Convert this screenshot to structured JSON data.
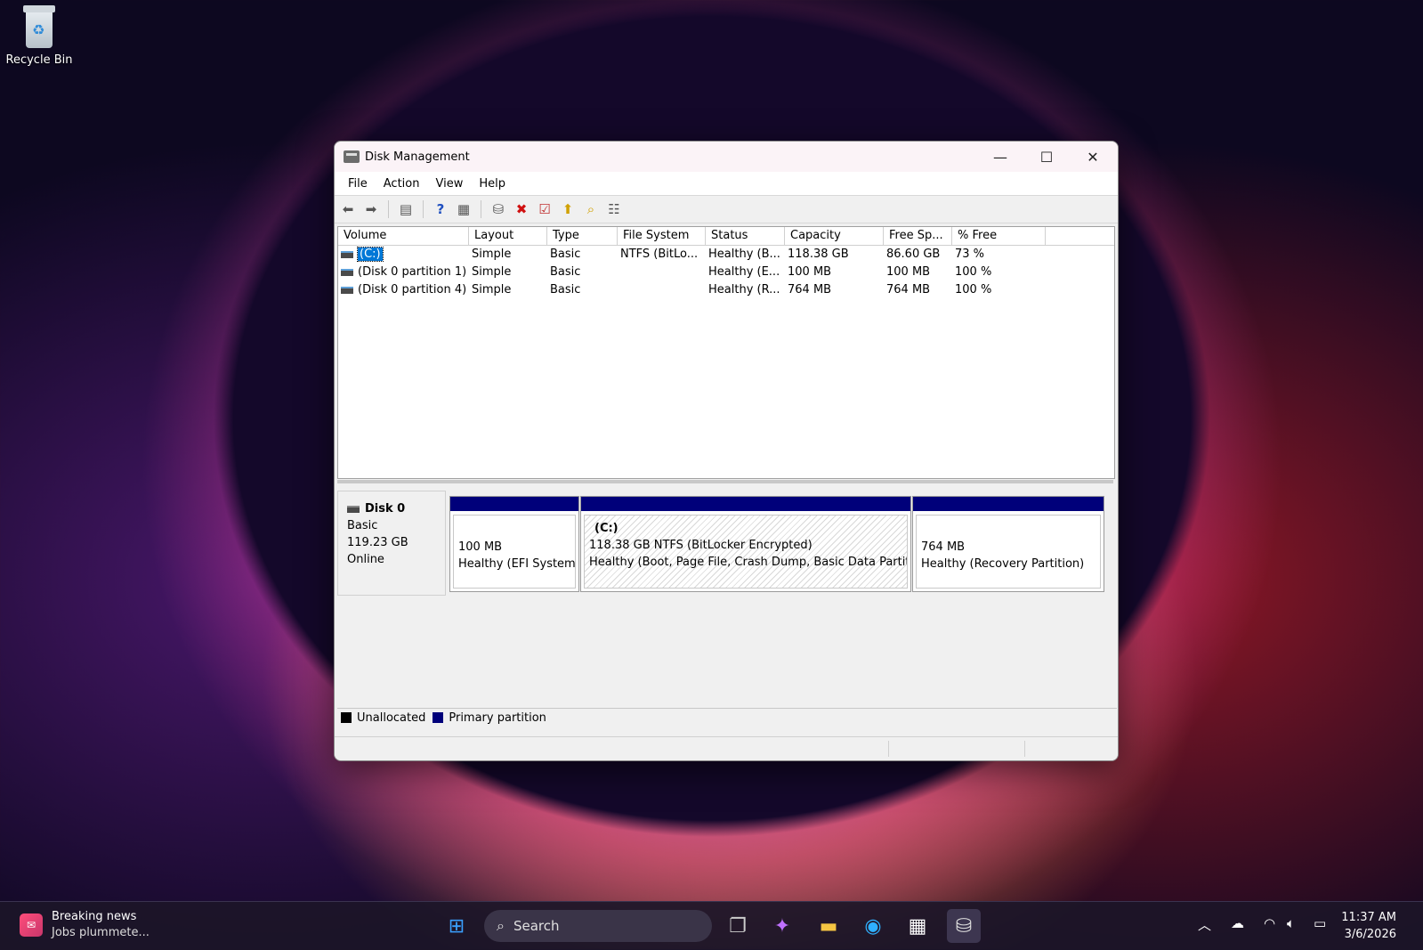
{
  "desktop": {
    "recycle_bin_label": "Recycle Bin"
  },
  "window": {
    "title": "Disk Management",
    "menu": [
      "File",
      "Action",
      "View",
      "Help"
    ],
    "columns": [
      "Volume",
      "Layout",
      "Type",
      "File System",
      "Status",
      "Capacity",
      "Free Sp...",
      "% Free"
    ],
    "rows": [
      {
        "volume": "(C:)",
        "layout": "Simple",
        "type": "Basic",
        "fs": "NTFS (BitLo...",
        "status": "Healthy (B...",
        "capacity": "118.38 GB",
        "free": "86.60 GB",
        "pct": "73 %"
      },
      {
        "volume": "(Disk 0 partition 1)",
        "layout": "Simple",
        "type": "Basic",
        "fs": "",
        "status": "Healthy (E...",
        "capacity": "100 MB",
        "free": "100 MB",
        "pct": "100 %"
      },
      {
        "volume": "(Disk 0 partition 4)",
        "layout": "Simple",
        "type": "Basic",
        "fs": "",
        "status": "Healthy (R...",
        "capacity": "764 MB",
        "free": "764 MB",
        "pct": "100 %"
      }
    ],
    "disk": {
      "name": "Disk 0",
      "type": "Basic",
      "size": "119.23 GB",
      "state": "Online",
      "partitions": [
        {
          "label": "",
          "size": "100 MB",
          "status": "Healthy (EFI System P"
        },
        {
          "label": "(C:)",
          "size": "118.38 GB NTFS (BitLocker Encrypted)",
          "status": "Healthy (Boot, Page File, Crash Dump, Basic Data Partition)"
        },
        {
          "label": "",
          "size": "764 MB",
          "status": "Healthy (Recovery Partition)"
        }
      ]
    },
    "legend": {
      "unallocated": "Unallocated",
      "primary": "Primary partition",
      "unallocated_color": "#000000",
      "primary_color": "#00007a"
    }
  },
  "taskbar": {
    "news_title": "Breaking news",
    "news_subtitle": "Jobs plummete...",
    "search_placeholder": "Search",
    "time": "11:37 AM",
    "date": "3/6/2026"
  }
}
